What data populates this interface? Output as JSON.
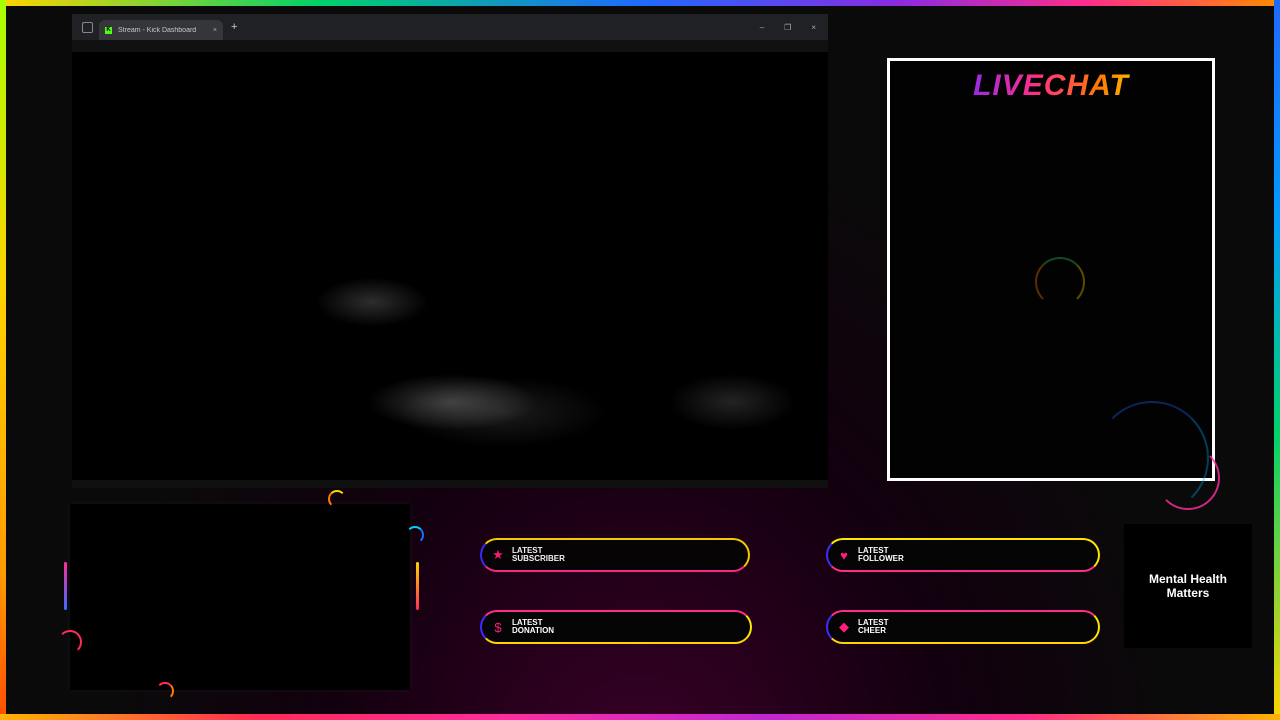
{
  "browser": {
    "tab_title": "Stream - Kick Dashboard",
    "tab_close": "×",
    "new_tab": "+",
    "window_controls": [
      "–",
      "❐",
      "×"
    ]
  },
  "chat": {
    "title": "LIVECHAT"
  },
  "alerts": {
    "subscriber": {
      "line1": "LATEST",
      "line2": "SUBSCRIBER"
    },
    "follower": {
      "line1": "LATEST",
      "line2": "FOLLOWER"
    },
    "donation": {
      "line1": "LATEST",
      "line2": "DONATION"
    },
    "cheer": {
      "line1": "LATEST",
      "line2": "CHEER"
    }
  },
  "message": {
    "line1": "Mental Health",
    "line2": "Matters"
  },
  "icons": {
    "subscriber": "star-icon",
    "follower": "heart-icon",
    "donation": "dollar-icon",
    "cheer": "diamond-icon"
  },
  "colors": {
    "accent_pink": "#ff1f7a",
    "accent_yellow": "#ffe600",
    "chat_border": "#ffffff"
  }
}
